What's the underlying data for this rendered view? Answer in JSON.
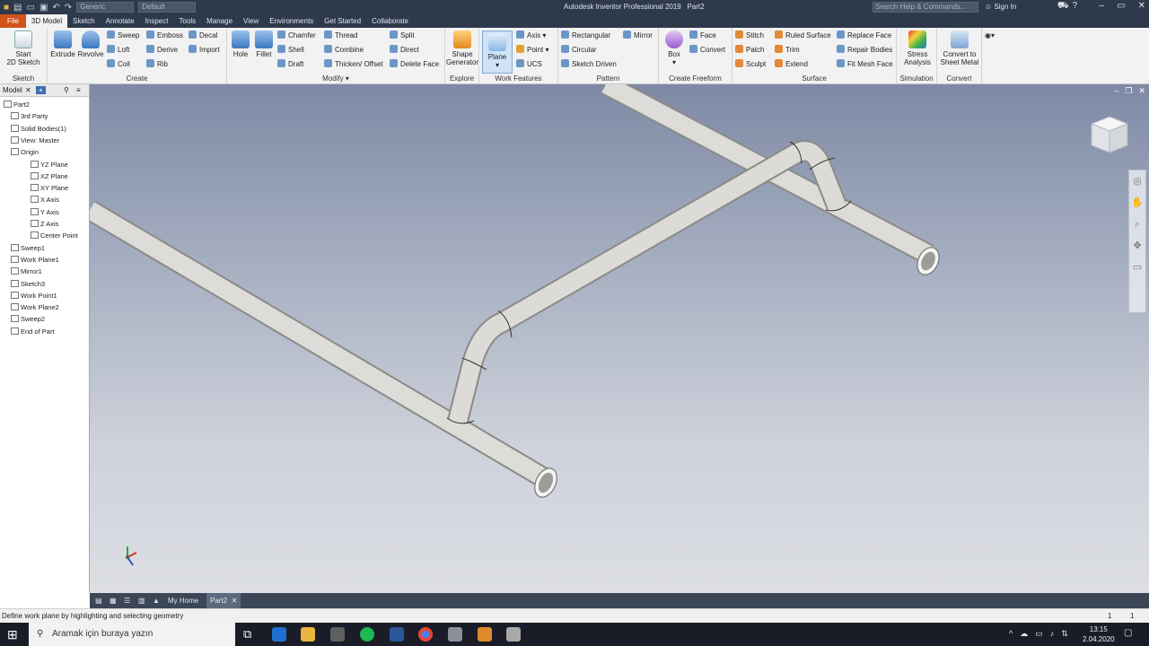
{
  "titlebar": {
    "app_title": "Autodesk Inventor Professional 2019",
    "doc_title": "Part2",
    "material_combo": "Generic",
    "appearance_combo": "Default",
    "search_placeholder": "Search Help & Commands...",
    "sign_in": "Sign In"
  },
  "tabs": [
    "File",
    "3D Model",
    "Sketch",
    "Annotate",
    "Inspect",
    "Tools",
    "Manage",
    "View",
    "Environments",
    "Get Started",
    "Collaborate"
  ],
  "ribbon": {
    "sketch": {
      "label": "Sketch",
      "start": "Start",
      "start2": "2D Sketch"
    },
    "create": {
      "label": "Create",
      "extrude": "Extrude",
      "revolve": "Revolve",
      "sweep": "Sweep",
      "loft": "Loft",
      "coil": "Coil",
      "emboss": "Emboss",
      "derive": "Derive",
      "rib": "Rib",
      "decal": "Decal",
      "import": "Import"
    },
    "modify": {
      "label": "Modify",
      "hole": "Hole",
      "fillet": "Fillet",
      "chamfer": "Chamfer",
      "shell": "Shell",
      "draft": "Draft",
      "thread": "Thread",
      "combine": "Combine",
      "thicken": "Thicken/ Offset",
      "split": "Split",
      "direct": "Direct",
      "delete_face": "Delete Face"
    },
    "explore": {
      "label": "Explore",
      "shape": "Shape",
      "shape2": "Generator"
    },
    "work_features": {
      "label": "Work Features",
      "plane": "Plane",
      "axis": "Axis",
      "point": "Point",
      "ucs": "UCS"
    },
    "pattern": {
      "label": "Pattern",
      "rectangular": "Rectangular",
      "circular": "Circular",
      "sketch_driven": "Sketch Driven",
      "mirror": "Mirror"
    },
    "freeform": {
      "label": "Create Freeform",
      "box": "Box",
      "face": "Face",
      "convert": "Convert"
    },
    "surface": {
      "label": "Surface",
      "stitch": "Stitch",
      "patch": "Patch",
      "sculpt": "Sculpt",
      "ruled": "Ruled Surface",
      "trim": "Trim",
      "extend": "Extend",
      "replace": "Replace Face",
      "repair": "Repair Bodies",
      "fit_mesh": "Fit Mesh Face"
    },
    "simulation": {
      "label": "Simulation",
      "stress": "Stress",
      "stress2": "Analysis"
    },
    "convert": {
      "label": "Convert",
      "sheet": "Convert to",
      "sheet2": "Sheet Metal"
    }
  },
  "browser": {
    "tab": "Model",
    "tree": [
      {
        "label": "Part2",
        "indent": 0
      },
      {
        "label": "3rd Party",
        "indent": 1
      },
      {
        "label": "Solid Bodies(1)",
        "indent": 1
      },
      {
        "label": "View: Master",
        "indent": 1
      },
      {
        "label": "Origin",
        "indent": 1
      },
      {
        "label": "YZ Plane",
        "indent": 2
      },
      {
        "label": "XZ Plane",
        "indent": 2
      },
      {
        "label": "XY Plane",
        "indent": 2
      },
      {
        "label": "X Axis",
        "indent": 2
      },
      {
        "label": "Y Axis",
        "indent": 2
      },
      {
        "label": "Z Axis",
        "indent": 2
      },
      {
        "label": "Center Point",
        "indent": 2
      },
      {
        "label": "Sweep1",
        "indent": 1
      },
      {
        "label": "Work Plane1",
        "indent": 1
      },
      {
        "label": "Mirror1",
        "indent": 1
      },
      {
        "label": "Sketch3",
        "indent": 1
      },
      {
        "label": "Work Point1",
        "indent": 1
      },
      {
        "label": "Work Plane2",
        "indent": 1
      },
      {
        "label": "Sweep2",
        "indent": 1
      },
      {
        "label": "End of Part",
        "indent": 1
      }
    ]
  },
  "doc_tabs": {
    "home": "My Home",
    "part": "Part2"
  },
  "status": {
    "message": "Define work plane by highlighting and selecting geometry",
    "count1": "1",
    "count2": "1"
  },
  "taskbar": {
    "search": "Aramak için buraya yazın",
    "time": "13:15",
    "date": "2.04.2020"
  },
  "colors": {
    "file_tab": "#d2531b",
    "title_bg": "#2e3a4b",
    "ribbon_bg": "#f2f2f2"
  }
}
